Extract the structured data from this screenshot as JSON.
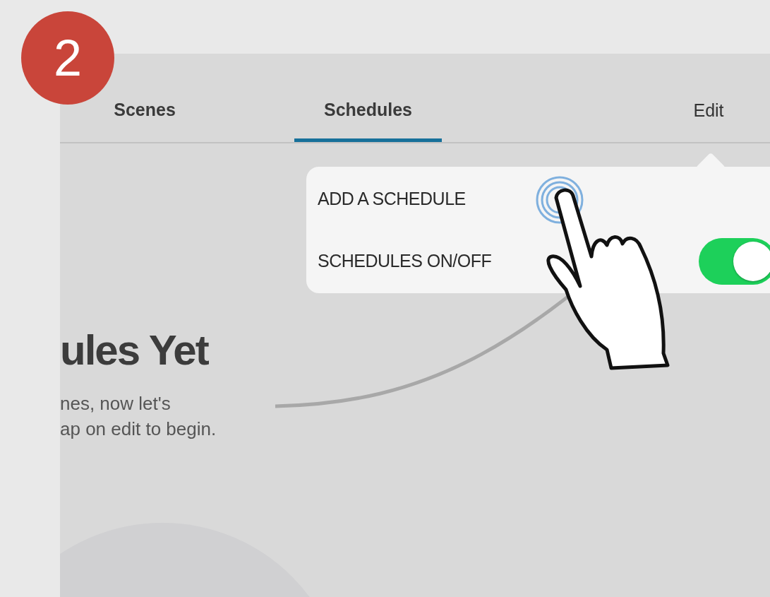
{
  "step_badge": {
    "number": "2"
  },
  "tabs": [
    {
      "label": "Scenes",
      "selected": false
    },
    {
      "label": "Schedules",
      "selected": true
    }
  ],
  "edit_button": {
    "label": "Edit"
  },
  "empty_state": {
    "title": "ules Yet",
    "message": "nes, now let's\nap on edit to begin."
  },
  "popover": {
    "items": [
      {
        "kind": "action",
        "label": "ADD A SCHEDULE"
      },
      {
        "kind": "toggle",
        "label": "SCHEDULES ON/OFF",
        "on": true
      }
    ]
  }
}
